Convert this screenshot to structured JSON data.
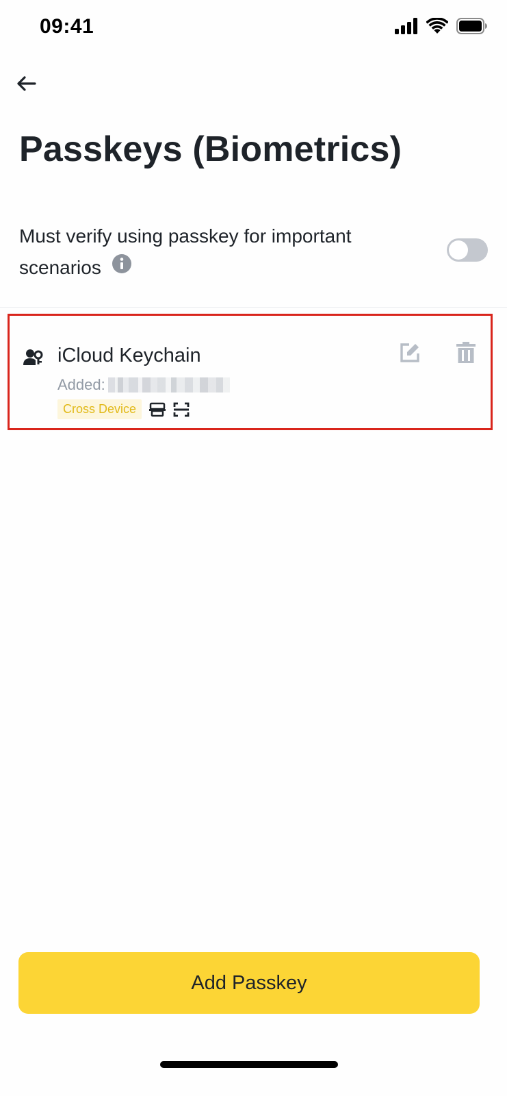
{
  "status_bar": {
    "time": "09:41",
    "icons": [
      "signal-icon",
      "wifi-icon",
      "battery-icon"
    ]
  },
  "header": {
    "back_icon": "arrow-left-icon",
    "title": "Passkeys (Biometrics)"
  },
  "setting": {
    "label": "Must verify using passkey for important scenarios",
    "info_icon": "info-icon",
    "toggle_on": false
  },
  "passkey": {
    "icon": "user-key-icon",
    "name": "iCloud Keychain",
    "added_label": "Added:",
    "badge": "Cross Device",
    "tag_icons": [
      "device-sync-icon",
      "qr-scan-icon"
    ],
    "edit_icon": "edit-icon",
    "delete_icon": "trash-icon"
  },
  "colors": {
    "accent": "#fcd535",
    "text_primary": "#1e2329",
    "text_secondary": "#929aa5",
    "badge_text": "#e1b917",
    "badge_bg": "#fdf6dc",
    "highlight_border": "#d9251c",
    "icon_muted": "#b7bdc6"
  },
  "footer": {
    "add_button_label": "Add Passkey"
  }
}
